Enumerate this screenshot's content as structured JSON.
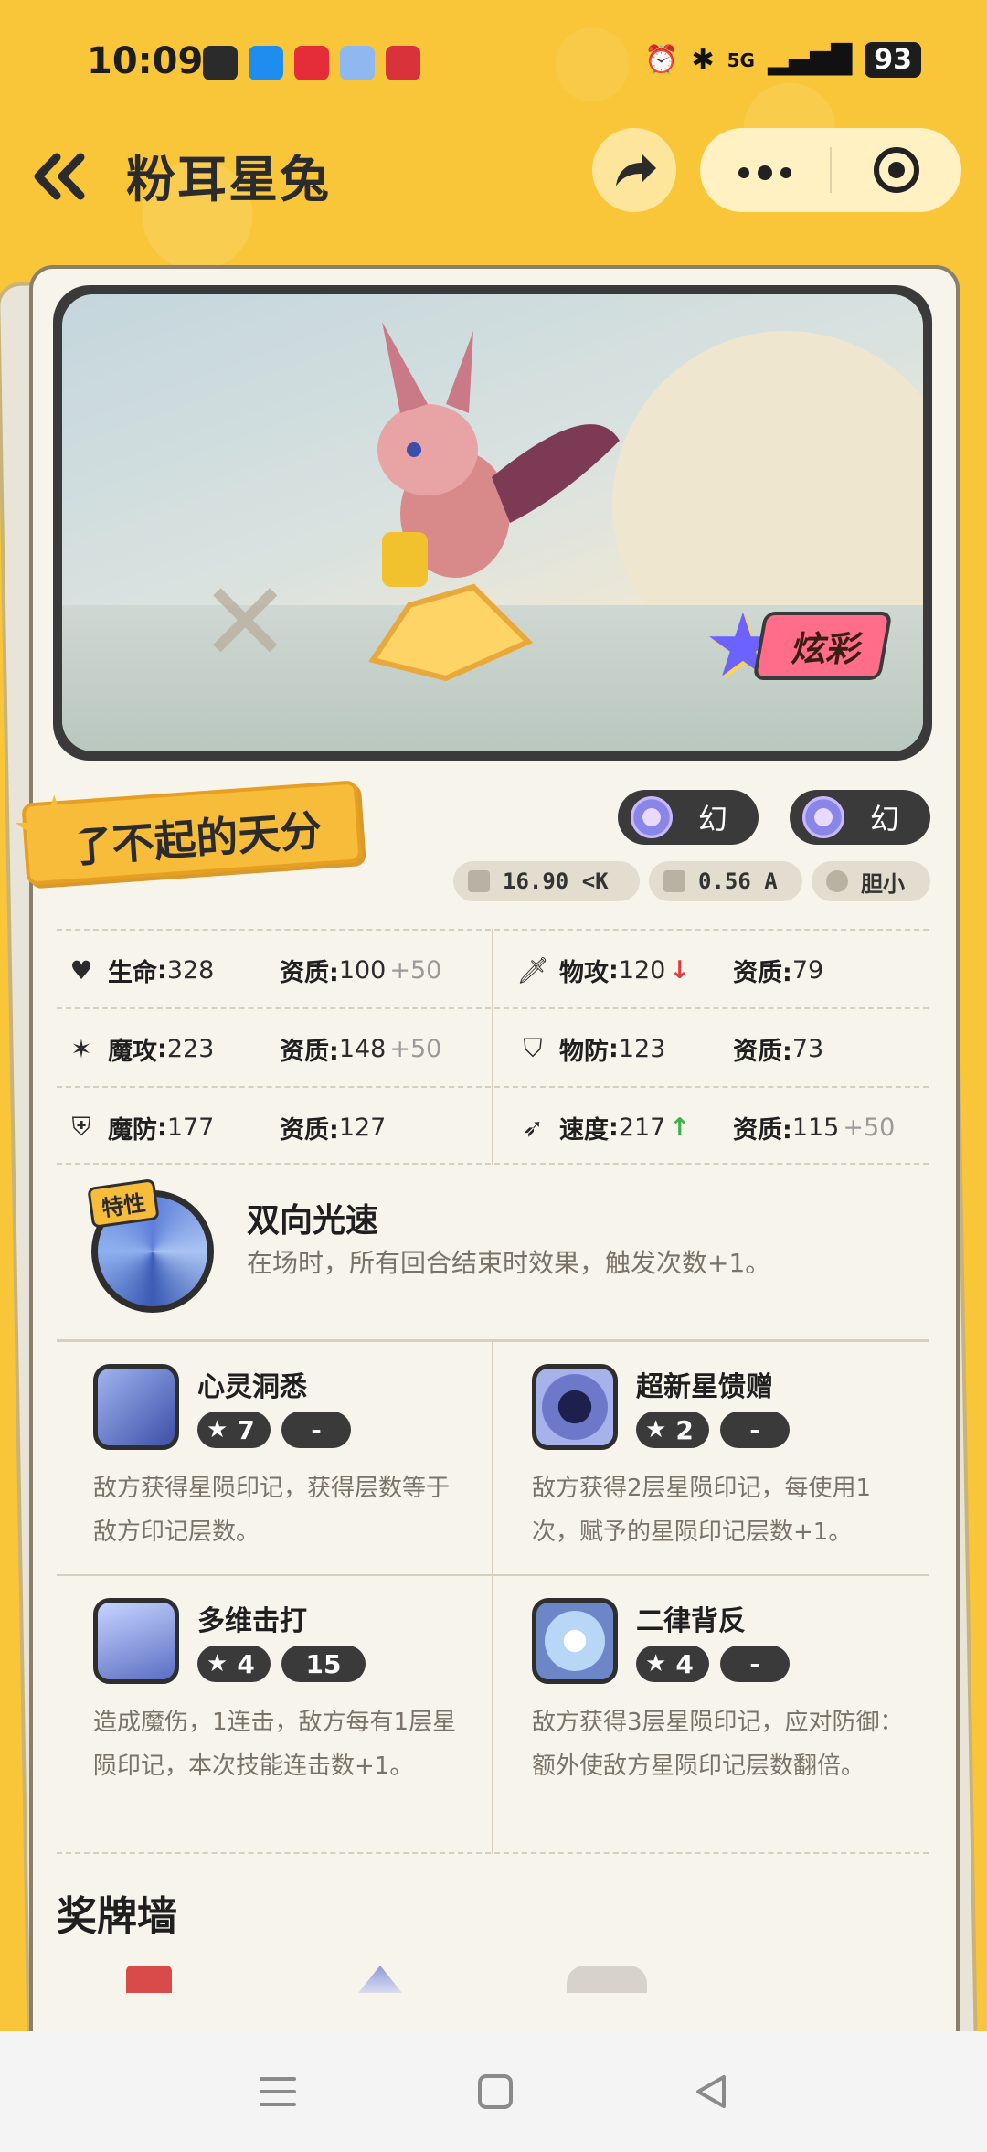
{
  "status_bar": {
    "time": "10:09",
    "network": "5G",
    "battery": "93",
    "notification_icons": [
      "app-icon-1",
      "app-icon-2",
      "app-icon-3",
      "app-icon-4",
      "app-icon-5"
    ]
  },
  "header": {
    "title": "粉耳星兔",
    "back_icon": "double-chevron-left-icon",
    "share_icon": "share-arrow-icon",
    "more_icon": "more-dots-icon",
    "target_icon": "target-circle-icon"
  },
  "hero": {
    "badge_label": "炫彩"
  },
  "talent": {
    "label": "了不起的天分"
  },
  "attributes": [
    {
      "label": "幻"
    },
    {
      "label": "幻"
    }
  ],
  "info_chips": {
    "weight": "16.90 <K",
    "height": "0.56 A",
    "nature": "胆小"
  },
  "stats": {
    "rows": [
      {
        "left": {
          "name": "生命",
          "value": "328",
          "apt_label": "资质:",
          "apt_value": "100",
          "apt_bonus": "+50"
        },
        "right": {
          "name": "物攻",
          "value": "120",
          "trend": "down",
          "apt_label": "资质:",
          "apt_value": "79",
          "apt_bonus": ""
        }
      },
      {
        "left": {
          "name": "魔攻",
          "value": "223",
          "apt_label": "资质:",
          "apt_value": "148",
          "apt_bonus": "+50"
        },
        "right": {
          "name": "物防",
          "value": "123",
          "trend": "",
          "apt_label": "资质:",
          "apt_value": "73",
          "apt_bonus": ""
        }
      },
      {
        "left": {
          "name": "魔防",
          "value": "177",
          "apt_label": "资质:",
          "apt_value": "127",
          "apt_bonus": ""
        },
        "right": {
          "name": "速度",
          "value": "217",
          "trend": "up",
          "apt_label": "资质:",
          "apt_value": "115",
          "apt_bonus": "+50"
        }
      }
    ]
  },
  "ability": {
    "tag": "特性",
    "name": "双向光速",
    "desc": "在场时，所有回合结束时效果，触发次数+1。"
  },
  "skills": [
    {
      "name": "心灵洞悉",
      "cost": "7",
      "power": "-",
      "desc": "敌方获得星陨印记，获得层数等于敌方印记层数。"
    },
    {
      "name": "超新星馈赠",
      "cost": "2",
      "power": "-",
      "desc": "敌方获得2层星陨印记，每使用1次，赋予的星陨印记层数+1。"
    },
    {
      "name": "多维击打",
      "cost": "4",
      "power": "15",
      "desc": "造成魔伤，1连击，敌方每有1层星陨印记，本次技能连击数+1。"
    },
    {
      "name": "二律背反",
      "cost": "4",
      "power": "-",
      "desc": "敌方获得3层星陨印记，应对防御：额外使敌方星陨印记层数翻倍。"
    }
  ],
  "medal_wall": {
    "title": "奖牌墙"
  },
  "colors": {
    "background": "#f8c638",
    "card": "#f7f4ec",
    "pill_dark": "#3a3a3a",
    "accent_orange": "#f6bc3a",
    "trend_down": "#e23b3b",
    "trend_up": "#3cb247"
  }
}
